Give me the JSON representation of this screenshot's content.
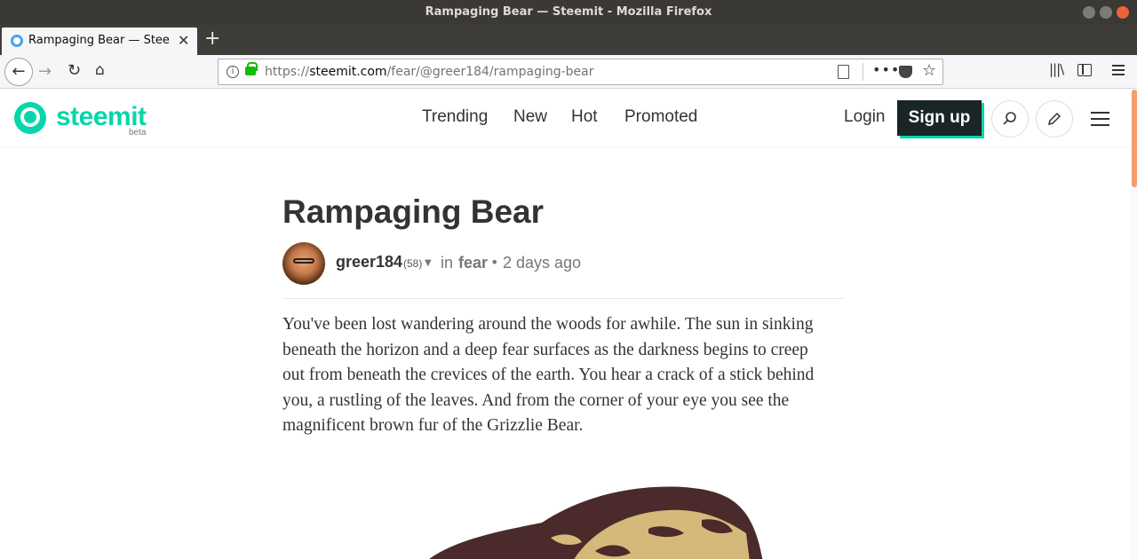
{
  "window": {
    "title": "Rampaging Bear — Steemit - Mozilla Firefox"
  },
  "tab": {
    "title": "Rampaging Bear — Steemit",
    "close": "✕",
    "new_tab": "+"
  },
  "urlbar": {
    "scheme": "https://",
    "host": "steemit.com",
    "path": "/fear/@greer184/rampaging-bear"
  },
  "site": {
    "logo": "steemit",
    "logo_badge": "beta",
    "nav": [
      "Trending",
      "New",
      "Hot",
      "Promoted"
    ],
    "login": "Login",
    "signup": "Sign up"
  },
  "post": {
    "title": "Rampaging Bear",
    "author": "greer184",
    "reputation": "(58)",
    "in_label": "in",
    "category": "fear",
    "time": "2 days ago",
    "body": "You've been lost wandering around the woods for awhile. The sun in sinking beneath the horizon and a deep fear surfaces as the darkness begins to creep out from beneath the crevices of the earth. You hear a crack of a stick behind you, a rustling of the leaves. And from the corner of your eye you see the magnificent brown fur of the Grizzlie Bear."
  },
  "colors": {
    "brand": "#06d6a9",
    "signup_bg": "#1a2526",
    "bear_dark": "#4a2a2a",
    "bear_light": "#d4b97a"
  }
}
